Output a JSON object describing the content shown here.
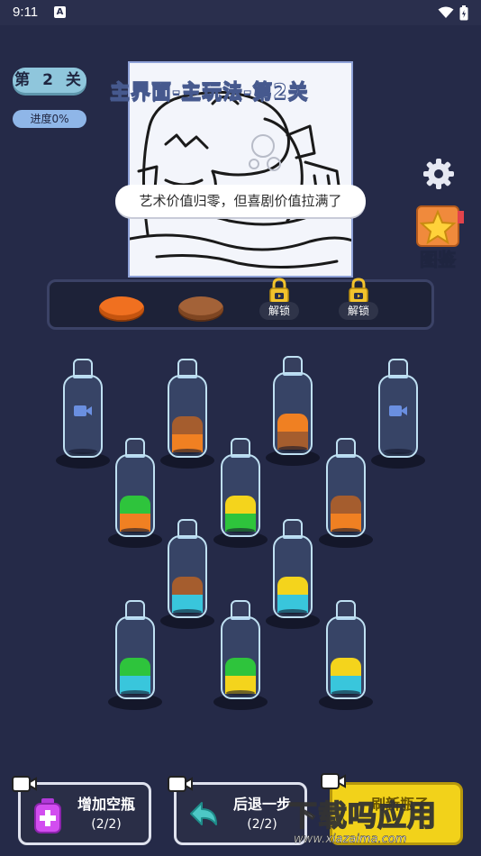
{
  "status_bar": {
    "time": "9:11",
    "notification_icon": "A"
  },
  "level": {
    "label": "第 2 关"
  },
  "progress": {
    "label": "进度0%",
    "value_percent": 0
  },
  "picture": {
    "title": "主界面-主玩法-第2关"
  },
  "speech": {
    "text": "艺术价值归零，但喜剧价值拉满了"
  },
  "collection": {
    "label": "图鉴"
  },
  "tray": {
    "unlock_label": "解锁",
    "dishes": [
      "orange",
      "brown"
    ]
  },
  "colors": {
    "orange": "#f08022",
    "brown": "#a55d2e",
    "green": "#2ec43c",
    "yellow": "#f4d41c",
    "cyan": "#39c6dc"
  },
  "bottles": [
    {
      "layers": [],
      "locked": true
    },
    {
      "layers": [
        "orange",
        "brown"
      ]
    },
    {
      "layers": [
        "brown",
        "orange"
      ]
    },
    {
      "layers": [],
      "locked": true
    },
    {
      "layers": [
        "orange",
        "green"
      ]
    },
    {
      "layers": [
        "green",
        "yellow"
      ]
    },
    {
      "layers": [
        "orange",
        "brown"
      ]
    },
    {
      "layers": [
        "cyan",
        "brown"
      ]
    },
    {
      "layers": [
        "cyan",
        "yellow"
      ]
    },
    {
      "layers": [
        "cyan",
        "green"
      ]
    },
    {
      "layers": [
        "yellow",
        "green"
      ]
    },
    {
      "layers": [
        "cyan",
        "yellow"
      ]
    }
  ],
  "buttons": {
    "add_bottle": {
      "label": "增加空瓶",
      "count": "(2/2)"
    },
    "undo": {
      "label": "后退一步",
      "count": "(2/2)"
    },
    "refresh": {
      "label": "刷新瓶子"
    }
  },
  "watermark": {
    "title": "下载吗应用",
    "url": "www.xiazaima.com"
  }
}
